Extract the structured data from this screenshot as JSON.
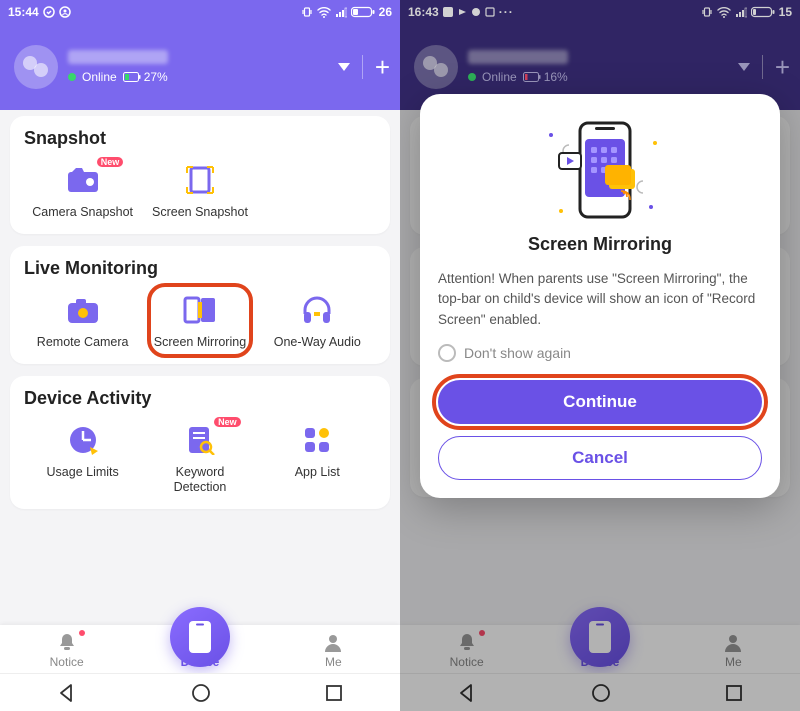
{
  "left": {
    "status_time": "15:44",
    "battery": "26",
    "user_status": "Online",
    "user_battery": "27%",
    "sections": {
      "snapshot": {
        "title": "Snapshot",
        "items": [
          {
            "label": "Camera Snapshot",
            "badge": "New"
          },
          {
            "label": "Screen Snapshot"
          }
        ]
      },
      "live": {
        "title": "Live Monitoring",
        "items": [
          {
            "label": "Remote Camera"
          },
          {
            "label": "Screen Mirroring"
          },
          {
            "label": "One-Way Audio"
          }
        ]
      },
      "activity": {
        "title": "Device Activity",
        "items": [
          {
            "label": "Usage Limits"
          },
          {
            "label": "Keyword\nDetection",
            "badge": "New"
          },
          {
            "label": "App List"
          }
        ]
      }
    },
    "tabs": {
      "notice": "Notice",
      "device": "Device",
      "me": "Me"
    }
  },
  "right": {
    "status_time": "16:43",
    "battery": "15",
    "user_status": "Online",
    "user_battery": "16%",
    "modal": {
      "title": "Screen Mirroring",
      "body": "Attention! When parents use \"Screen Mirroring\", the top-bar on child's device will show an icon of \"Record Screen\" enabled.",
      "dontshow": "Don't show again",
      "continue": "Continue",
      "cancel": "Cancel"
    }
  }
}
